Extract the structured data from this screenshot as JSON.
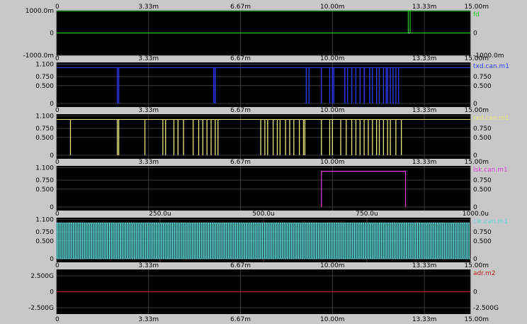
{
  "chart_data": [
    {
      "type": "line",
      "title": "",
      "series": [
        {
          "name": "fd",
          "color": "#1ec81e"
        }
      ],
      "xlim": [
        0,
        15.0
      ],
      "x_unit": "m",
      "x_tick_labels": [
        "0",
        "3.33m",
        "6.67m",
        "10.00m",
        "13.33m",
        "15.00m"
      ],
      "x_tick_values": [
        0,
        3.333,
        6.667,
        10.0,
        13.333,
        15.0
      ],
      "ylim": [
        -1000,
        1000
      ],
      "y_ticks": [
        {
          "v": 1000,
          "label": "1000.0m"
        },
        {
          "v": 0,
          "label": "0"
        },
        {
          "v": -1000,
          "label": "-1000.0m"
        }
      ],
      "right_ticks": [
        {
          "v": 0,
          "label": "0"
        },
        {
          "v": -1000,
          "label": "-1000.0m"
        }
      ],
      "top_line": true,
      "mode": "steps",
      "points": [
        [
          0,
          0
        ],
        [
          12.75,
          0
        ],
        [
          12.75,
          1000
        ],
        [
          12.82,
          1000
        ],
        [
          12.82,
          0
        ],
        [
          15,
          0
        ]
      ],
      "baseline": {
        "value": 0,
        "color": "#ffffff"
      }
    },
    {
      "type": "line",
      "title": "",
      "series": [
        {
          "name": "txd.can.m1",
          "color": "#2b3cff"
        }
      ],
      "xlim": [
        0,
        15.0
      ],
      "x_unit": "m",
      "x_tick_labels": [
        "0",
        "3.33m",
        "6.67m",
        "10.00m",
        "13.33m",
        "15.00m"
      ],
      "x_tick_values": [
        0,
        3.333,
        6.667,
        10.0,
        13.333,
        15.0
      ],
      "ylim": [
        -0.1,
        1.15
      ],
      "y_ticks": [
        {
          "v": 1.1,
          "label": "1.100"
        },
        {
          "v": 0.75,
          "label": "0.750"
        },
        {
          "v": 0.5,
          "label": "0.500"
        },
        {
          "v": 0,
          "label": "0"
        }
      ],
      "right_ticks": [
        {
          "v": 0.75,
          "label": "0.750"
        },
        {
          "v": 0.5,
          "label": "0.500"
        },
        {
          "v": 0,
          "label": "0"
        }
      ],
      "mode": "pulses",
      "high": 1.0,
      "low": 0,
      "pulse_top": 1.0,
      "pulse_bottom": 0.0,
      "line_level": 1.0,
      "pulses": [
        2.2,
        2.25,
        5.7,
        5.75,
        9.05,
        9.15,
        9.6,
        9.9,
        10.0,
        10.05,
        10.45,
        10.55,
        10.7,
        10.85,
        11.0,
        11.15,
        11.35,
        11.45,
        11.6,
        11.7,
        11.85,
        11.95,
        12.0,
        12.1,
        12.2,
        12.3,
        12.4
      ]
    },
    {
      "type": "line",
      "title": "",
      "series": [
        {
          "name": "rxd.can.m1",
          "color": "#e8e87a"
        }
      ],
      "xlim": [
        0,
        15.0
      ],
      "x_unit": "m",
      "x_tick_labels": [
        "0",
        "3.33m",
        "6.67m",
        "10.00m",
        "13.33m",
        "15.00m"
      ],
      "x_tick_values": [
        0,
        3.333,
        6.667,
        10.0,
        13.333,
        15.0
      ],
      "ylim": [
        -0.1,
        1.15
      ],
      "y_ticks": [
        {
          "v": 1.1,
          "label": "1.100"
        },
        {
          "v": 0.75,
          "label": "0.750"
        },
        {
          "v": 0.5,
          "label": "0.500"
        },
        {
          "v": 0,
          "label": "0"
        }
      ],
      "right_ticks": [
        {
          "v": 0.75,
          "label": "0.750"
        },
        {
          "v": 0.5,
          "label": "0.500"
        },
        {
          "v": 0,
          "label": "0"
        }
      ],
      "mode": "pulses",
      "high": 1.0,
      "low": 0,
      "pulse_top": 1.0,
      "pulse_bottom": 0.0,
      "line_level": 1.0,
      "pulses": [
        0.5,
        2.2,
        2.25,
        3.2,
        3.85,
        3.95,
        4.25,
        4.4,
        4.6,
        4.95,
        5.15,
        5.3,
        5.45,
        5.6,
        5.75,
        5.85,
        7.4,
        7.55,
        7.65,
        7.85,
        8.0,
        8.1,
        8.3,
        8.45,
        8.6,
        8.8,
        8.95,
        9.0,
        9.6,
        9.9,
        10.0,
        10.3,
        10.5,
        10.7,
        10.85,
        11.0,
        11.15,
        11.3,
        11.45,
        11.6,
        11.7,
        11.85,
        12.0,
        12.1,
        12.3,
        12.5
      ]
    },
    {
      "type": "line",
      "title": "",
      "series": [
        {
          "name": "lsk.can.m1",
          "color": "#e040e0"
        }
      ],
      "xlim": [
        0,
        15.0
      ],
      "x_unit": "m",
      "x_tick_labels": [
        "0",
        "3.33m",
        "6.67m",
        "10.00m",
        "13.33m",
        "15.00m"
      ],
      "x_tick_values": [
        0,
        3.333,
        6.667,
        10.0,
        13.333,
        15.0
      ],
      "ylim": [
        -0.1,
        1.15
      ],
      "y_ticks": [
        {
          "v": 1.1,
          "label": "1.100"
        },
        {
          "v": 0.75,
          "label": "0.750"
        },
        {
          "v": 0.5,
          "label": "0.500"
        },
        {
          "v": 0,
          "label": "0"
        }
      ],
      "right_ticks": [
        {
          "v": 0.75,
          "label": "0.750"
        },
        {
          "v": 0.5,
          "label": "0.500"
        },
        {
          "v": 0,
          "label": "0"
        }
      ],
      "mode": "steps",
      "points": [
        [
          9.6,
          0
        ],
        [
          9.6,
          1.0
        ],
        [
          12.65,
          1.0
        ],
        [
          12.65,
          0
        ]
      ]
    },
    {
      "type": "line",
      "title": "",
      "series": [
        {
          "name": "clk.can.m1",
          "color": "#5fd8d8"
        }
      ],
      "xlim": [
        0,
        1000
      ],
      "x_unit": "u",
      "x_tick_labels": [
        "0",
        "250.0u",
        "500.0u",
        "750.0u",
        "1000.0u"
      ],
      "x_tick_values": [
        0,
        250,
        500,
        750,
        1000
      ],
      "ylim": [
        -0.1,
        1.15
      ],
      "y_ticks": [
        {
          "v": 1.1,
          "label": "1.100"
        },
        {
          "v": 0.75,
          "label": "0.750"
        },
        {
          "v": 0.5,
          "label": "0.500"
        },
        {
          "v": 0,
          "label": "0"
        }
      ],
      "right_ticks": [
        {
          "v": 0.75,
          "label": "0.750"
        },
        {
          "v": 0.5,
          "label": "0.500"
        },
        {
          "v": 0,
          "label": "0"
        }
      ],
      "mode": "clock",
      "period": 5,
      "high": 1.0,
      "low": 0
    },
    {
      "type": "line",
      "title": "",
      "series": [
        {
          "name": "adr.m2",
          "color": "#c02020"
        }
      ],
      "xlim": [
        0,
        15.0
      ],
      "x_unit": "m",
      "x_tick_labels": [
        "0",
        "3.33m",
        "6.67m",
        "10.00m",
        "13.33m",
        "15.00m"
      ],
      "x_tick_values": [
        0,
        3.333,
        6.667,
        10.0,
        13.333,
        15.0
      ],
      "ylim": [
        -3.5,
        3.5
      ],
      "y_ticks": [
        {
          "v": 2.5,
          "label": "2.500G"
        },
        {
          "v": 0,
          "label": "0"
        },
        {
          "v": -2.5,
          "label": "-2.500G"
        }
      ],
      "right_ticks": [
        {
          "v": 0,
          "label": "0"
        },
        {
          "v": -2.5,
          "label": "-2.500G"
        }
      ],
      "mode": "steps",
      "points": [
        [
          0,
          0
        ],
        [
          15,
          0
        ]
      ]
    }
  ]
}
